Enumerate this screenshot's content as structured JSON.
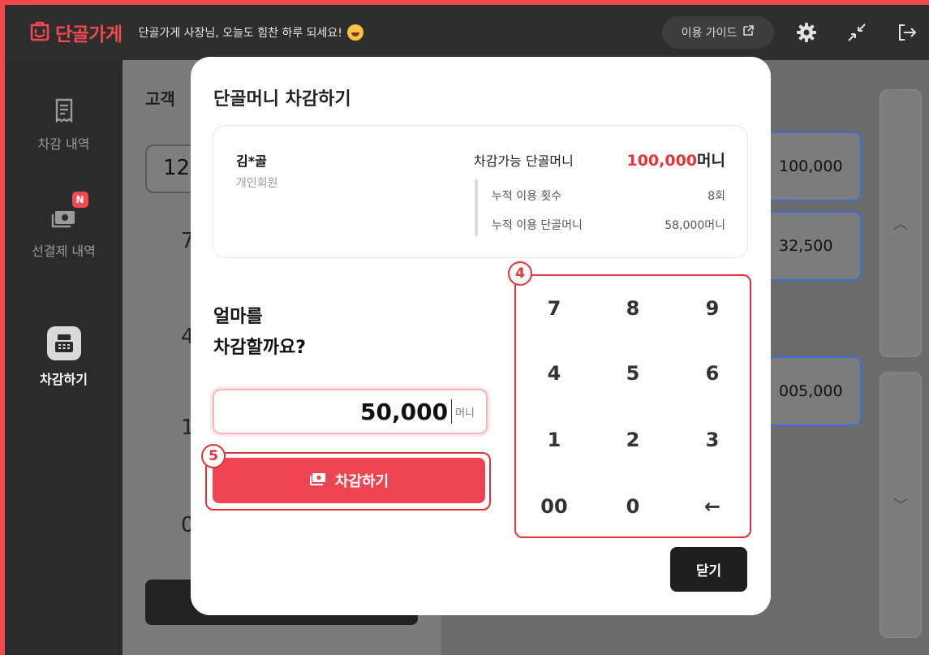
{
  "app": {
    "logo_text": "단골가게",
    "greeting": "단골가게 사장님, 오늘도 힘찬 하루 되세요!",
    "guide_label": "이용 가이드",
    "accent_color": "#f04a4f"
  },
  "sidebar": {
    "items": [
      {
        "label": "차감 내역",
        "icon": "receipt-icon"
      },
      {
        "label": "선결제 내역",
        "icon": "cash-icon",
        "badge": "N"
      },
      {
        "label": "차감하기",
        "icon": "cash-register-icon",
        "active": true
      }
    ]
  },
  "background": {
    "section_title": "고객",
    "input_partial": "12",
    "card_values": [
      "100,000",
      "32,500",
      "005,000"
    ]
  },
  "modal": {
    "title": "단골머니 차감하기",
    "customer": {
      "name": "김*골",
      "type": "개인회원"
    },
    "available": {
      "label": "차감가능 단골머니",
      "amount": "100,000",
      "unit": "머니"
    },
    "stats": [
      {
        "label": "누적 이용 횟수",
        "value": "8회"
      },
      {
        "label": "누적 이용 단골머니",
        "value": "58,000머니"
      }
    ],
    "question_line1": "얼마를",
    "question_line2": "차감할까요?",
    "amount": {
      "value": "50,000",
      "unit": "머니"
    },
    "deduct_label": "차감하기",
    "keypad": {
      "keys": [
        "7",
        "8",
        "9",
        "4",
        "5",
        "6",
        "1",
        "2",
        "3",
        "00",
        "0",
        "←"
      ]
    },
    "close_label": "닫기",
    "step_badges": [
      "4",
      "5"
    ]
  }
}
